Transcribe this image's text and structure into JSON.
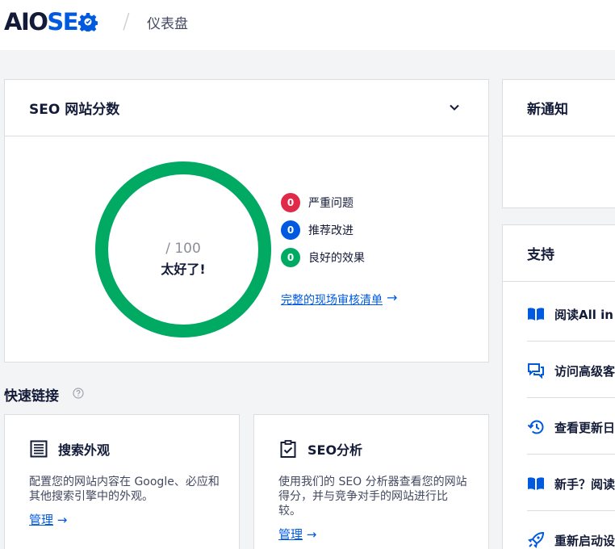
{
  "header": {
    "logo_left": "AIO",
    "logo_right": "SE",
    "separator": "/",
    "breadcrumb": "仪表盘"
  },
  "score_card": {
    "title": "SEO 网站分数",
    "score_total": "/ 100",
    "score_label": "太好了!",
    "score_fraction": 1.0,
    "ring_color": "#00aa63",
    "legend": [
      {
        "count": "0",
        "label": "严重问题",
        "color": "#df2a4a"
      },
      {
        "count": "0",
        "label": "推荐改进",
        "color": "#005ae0"
      },
      {
        "count": "0",
        "label": "良好的效果",
        "color": "#00aa63"
      }
    ],
    "audit_link": "完整的现场审核清单",
    "audit_arrow": "→"
  },
  "quick_links": {
    "title": "快速链接",
    "cards": [
      {
        "icon": "list-icon",
        "title": "搜索外观",
        "description": "配置您的网站内容在 Google、必应和其他搜索引擎中的外观。",
        "manage": "管理",
        "arrow": "→"
      },
      {
        "icon": "clipboard-check-icon",
        "title": "SEO分析",
        "description": "使用我们的 SEO 分析器查看您的网站得分，并与竞争对手的网站进行比较。",
        "manage": "管理",
        "arrow": "→"
      }
    ]
  },
  "notices": {
    "title": "新通知"
  },
  "support": {
    "title": "支持",
    "items": [
      {
        "icon": "book-icon",
        "label": "阅读All in"
      },
      {
        "icon": "chat-icon",
        "label": "访问高级客"
      },
      {
        "icon": "history-icon",
        "label": "查看更新日"
      },
      {
        "icon": "book-icon",
        "label": "新手？阅读"
      },
      {
        "icon": "rocket-icon",
        "label": "重新启动设"
      }
    ]
  },
  "colors": {
    "accent": "#005ae0",
    "good": "#00aa63",
    "critical": "#df2a4a",
    "text": "#141b38"
  }
}
